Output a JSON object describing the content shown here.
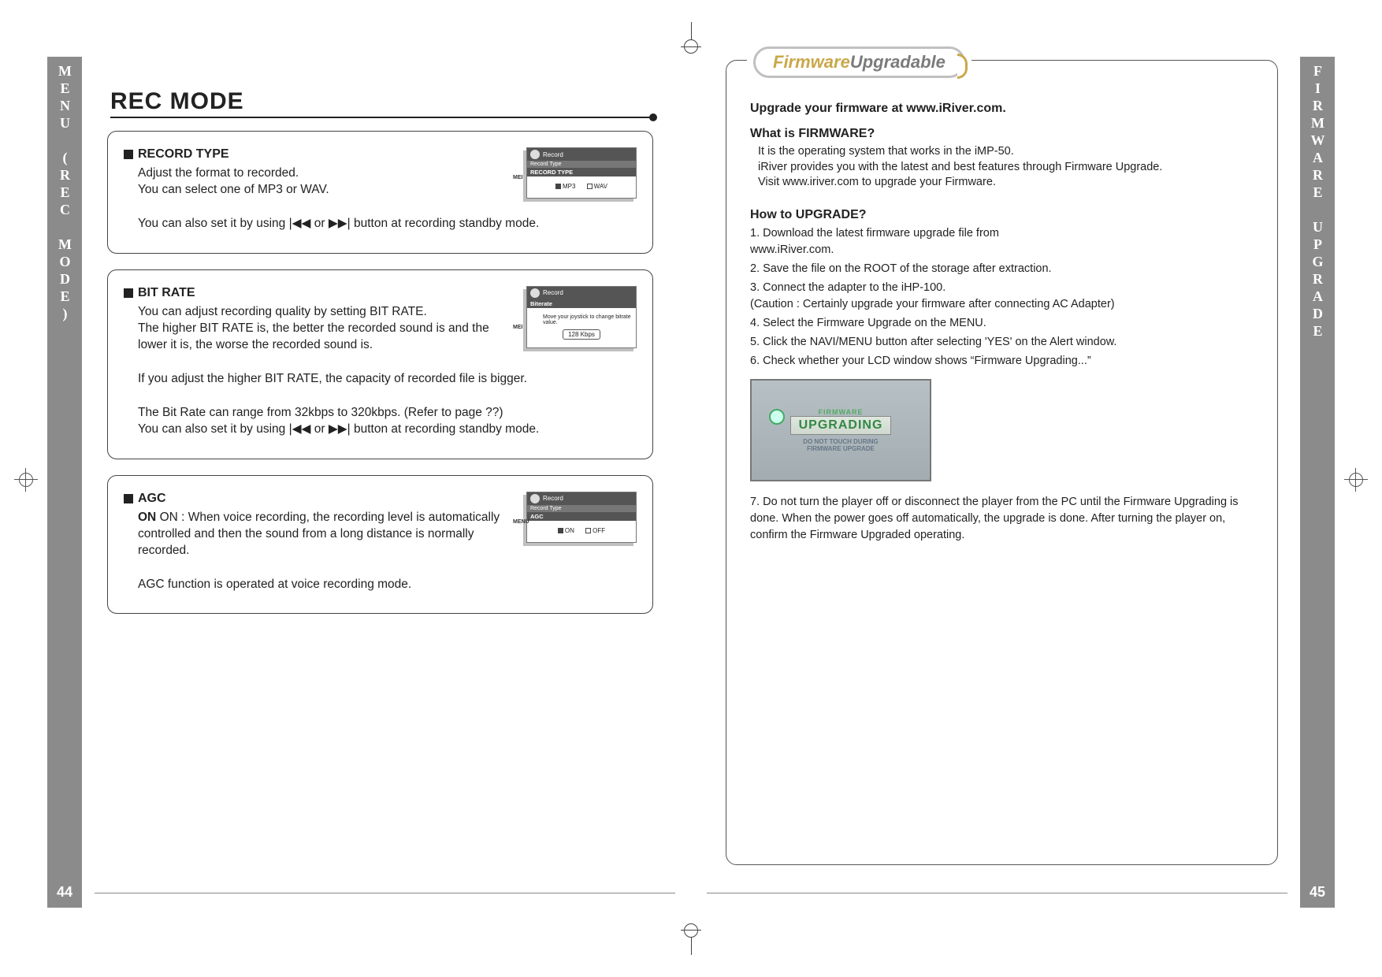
{
  "leftPage": {
    "sideTab": "MENU (REC MODE)",
    "pageNumber": "44",
    "mainTitle": "REC MODE",
    "sections": [
      {
        "title": "RECORD TYPE",
        "paras": [
          "Adjust the format to recorded.",
          "You can select one of MP3 or WAV.",
          "",
          "You can also set it by using |◀◀ or ▶▶| button at recording standby mode."
        ],
        "lcd": {
          "header": "Record",
          "sub": "Record Type",
          "bar": "RECORD TYPE",
          "options": [
            {
              "label": "MP3",
              "selected": true
            },
            {
              "label": "WAV",
              "selected": false
            }
          ],
          "sideLabel": "MEI"
        }
      },
      {
        "title": "BIT RATE",
        "paras": [
          "You can adjust recording quality by setting BIT RATE.",
          "The higher BIT RATE is, the better the recorded sound is and the lower it is, the worse the recorded sound is.",
          "",
          "If you adjust the higher BIT RATE, the capacity of recorded file is bigger.",
          "",
          "The Bit Rate can range from 32kbps to 320kbps. (Refer to page ??)",
          "You can also set it by using |◀◀ or ▶▶| button at recording standby mode."
        ],
        "lcd": {
          "header": "Record",
          "sub": "",
          "bar": "Biterate",
          "hint": "Move your joystick to change bitrate value.",
          "chip": "128 Kbps",
          "sideLabel": "MEI"
        }
      },
      {
        "title": "AGC",
        "paras": [
          "ON : When voice recording, the recording level is automatically controlled and then the sound from a long distance is normally recorded.",
          "",
          "AGC function is operated at voice recording mode."
        ],
        "boldLead": "ON",
        "lcd": {
          "header": "Record",
          "sub": "Record Type",
          "bar": "AGC",
          "options": [
            {
              "label": "ON",
              "selected": true
            },
            {
              "label": "OFF",
              "selected": false
            }
          ],
          "sideLabel": "MENU"
        }
      }
    ]
  },
  "rightPage": {
    "sideTab": "FIRMWARE UPGRADE",
    "pageNumber": "45",
    "badge": {
      "word1": "Firmware",
      "word2": "Upgradable"
    },
    "intro": "Upgrade your firmware at www.iRiver.com.",
    "whatTitle": "What is FIRMWARE?",
    "whatBody": [
      "It is the operating system that works in the iMP-50.",
      "iRiver provides you with the latest and best features through Firmware Upgrade.",
      "Visit www.iriver.com to upgrade your Firmware."
    ],
    "howTitle": "How to UPGRADE?",
    "steps": [
      "1. Download the latest firmware upgrade file from\n    www.iRiver.com.",
      "2. Save the file on the ROOT of the storage after extraction.",
      "3. Connect the adapter to the iHP-100.\n    (Caution : Certainly upgrade your firmware after connecting AC Adapter)",
      "4. Select the Firmware Upgrade on the MENU.",
      "5. Click the NAVI/MENU button after selecting  'YES'  on the Alert window.",
      "6. Check whether your LCD window shows “Firmware Upgrading...”"
    ],
    "upgradeImage": {
      "line1": "FIRMWARE",
      "line2": "UPGRADING",
      "line3": "DO NOT TOUCH DURING",
      "line4": "FIRMWARE UPGRADE"
    },
    "step7": "7. Do not turn the player off or disconnect the player from the PC until the Firmware Upgrading is done. When the power goes off automatically, the upgrade is done. After turning the player on, confirm the Firmware Upgraded operating."
  }
}
